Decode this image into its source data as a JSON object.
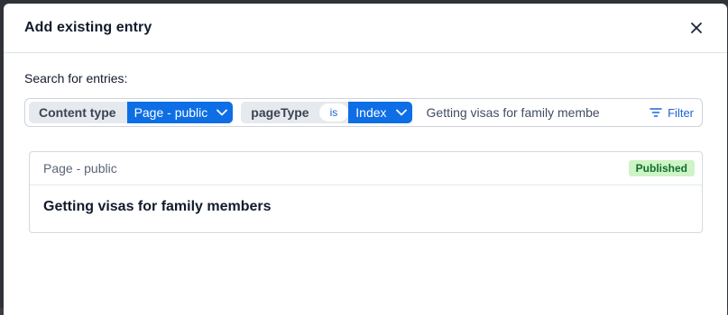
{
  "modal": {
    "title": "Add existing entry"
  },
  "search": {
    "label": "Search for entries:",
    "filters": [
      {
        "key": "Content type",
        "value": "Page - public"
      },
      {
        "key": "pageType",
        "operator": "is",
        "value": "Index"
      }
    ],
    "query": "Getting visas for family membe",
    "filter_button": "Filter"
  },
  "results": [
    {
      "content_type": "Page - public",
      "status": "Published",
      "title": "Getting visas for family members"
    }
  ],
  "colors": {
    "accent": "#0e6ee6",
    "published_bg": "#cdf3c6",
    "published_text": "#0f6e2b"
  }
}
